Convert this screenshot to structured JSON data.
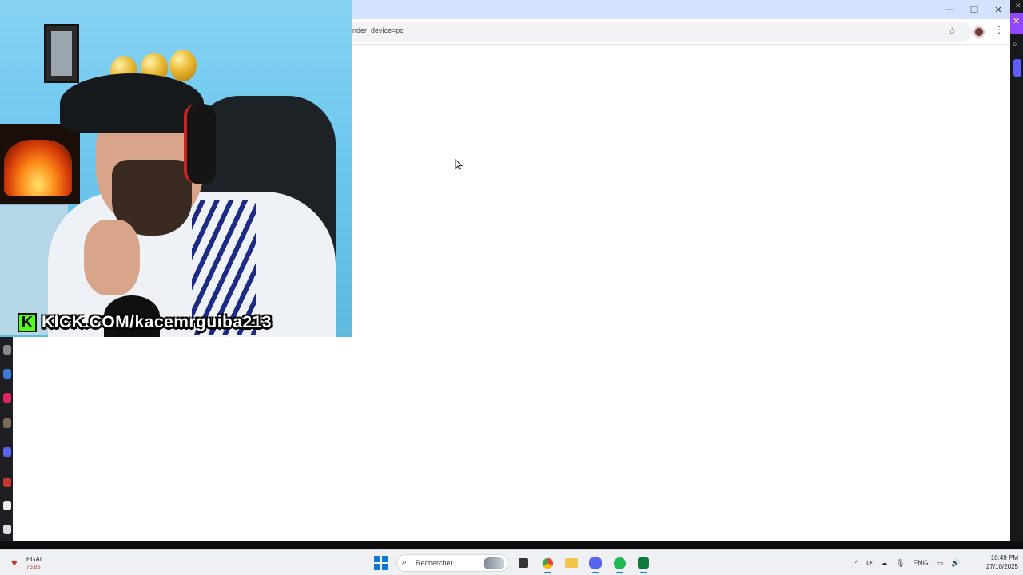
{
  "browser": {
    "url_fragment": "nder_device=pc",
    "window_controls": [
      "minimize",
      "restore",
      "close"
    ]
  },
  "webcam": {
    "banner_letter": "K",
    "banner_text": "KICK.COM/kacemrguiba213"
  },
  "taskbar": {
    "widget": {
      "title": "EGAL",
      "subtitle": "75,85"
    },
    "search_placeholder": "Rechercher",
    "tray_language": "ENG",
    "time": "10:49 PM",
    "date": "27/10/2025"
  },
  "colors": {
    "accent": "#0a78d4",
    "titlebar": "#d3e3fd",
    "kick_green": "#53fc18",
    "twitch_purple": "#9146ff"
  },
  "icons": {
    "taskbar_apps": [
      "windows-start-icon",
      "search-icon",
      "file-manager-icon",
      "chrome-icon",
      "folder-icon",
      "discord-icon",
      "spotify-icon",
      "android-app-icon"
    ]
  }
}
